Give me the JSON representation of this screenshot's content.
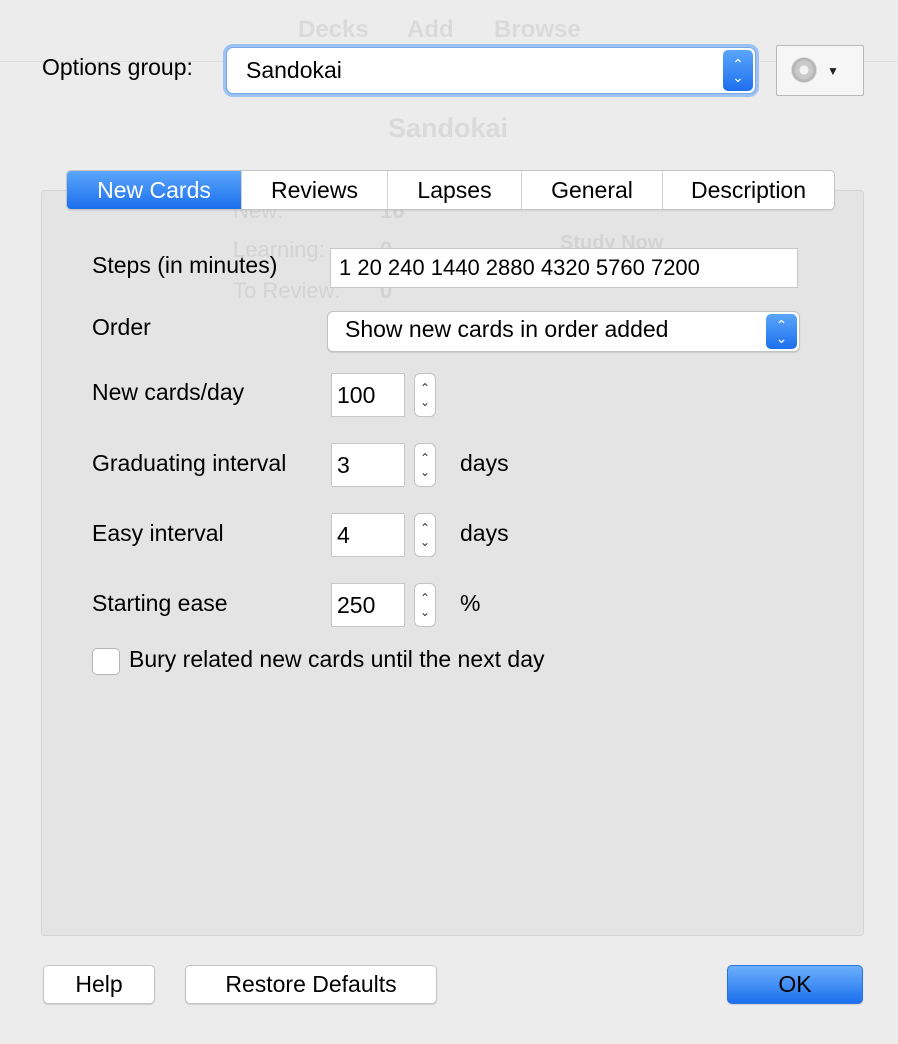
{
  "background_window": {
    "toolbar": [
      "Decks",
      "Add",
      "Browse"
    ],
    "deck_title": "Sandokai",
    "stats": [
      {
        "label": "New:",
        "value": "16"
      },
      {
        "label": "Learning:",
        "value": "0"
      },
      {
        "label": "To Review:",
        "value": "0"
      }
    ],
    "study_button": "Study Now"
  },
  "options_group": {
    "label": "Options group:",
    "selected": "Sandokai",
    "gear_icon": "gear-icon",
    "caret_icon": "chevron-down-icon"
  },
  "tabs": [
    {
      "label": "New Cards",
      "active": true
    },
    {
      "label": "Reviews",
      "active": false
    },
    {
      "label": "Lapses",
      "active": false
    },
    {
      "label": "General",
      "active": false
    },
    {
      "label": "Description",
      "active": false
    }
  ],
  "form": {
    "steps_label": "Steps (in minutes)",
    "steps_value": "1 20 240 1440 2880 4320 5760 7200",
    "order_label": "Order",
    "order_value": "Show new cards in order added",
    "new_per_day_label": "New cards/day",
    "new_per_day_value": "100",
    "grad_interval_label": "Graduating interval",
    "grad_interval_value": "3",
    "grad_interval_unit": "days",
    "easy_interval_label": "Easy interval",
    "easy_interval_value": "4",
    "easy_interval_unit": "days",
    "starting_ease_label": "Starting ease",
    "starting_ease_value": "250",
    "starting_ease_unit": "%",
    "bury_label": "Bury related new cards until the next day",
    "bury_checked": false
  },
  "buttons": {
    "help": "Help",
    "restore": "Restore Defaults",
    "ok": "OK"
  },
  "colors": {
    "accent": "#1c6fee",
    "window_bg": "#ececec",
    "panel_bg": "#e4e4e4"
  }
}
